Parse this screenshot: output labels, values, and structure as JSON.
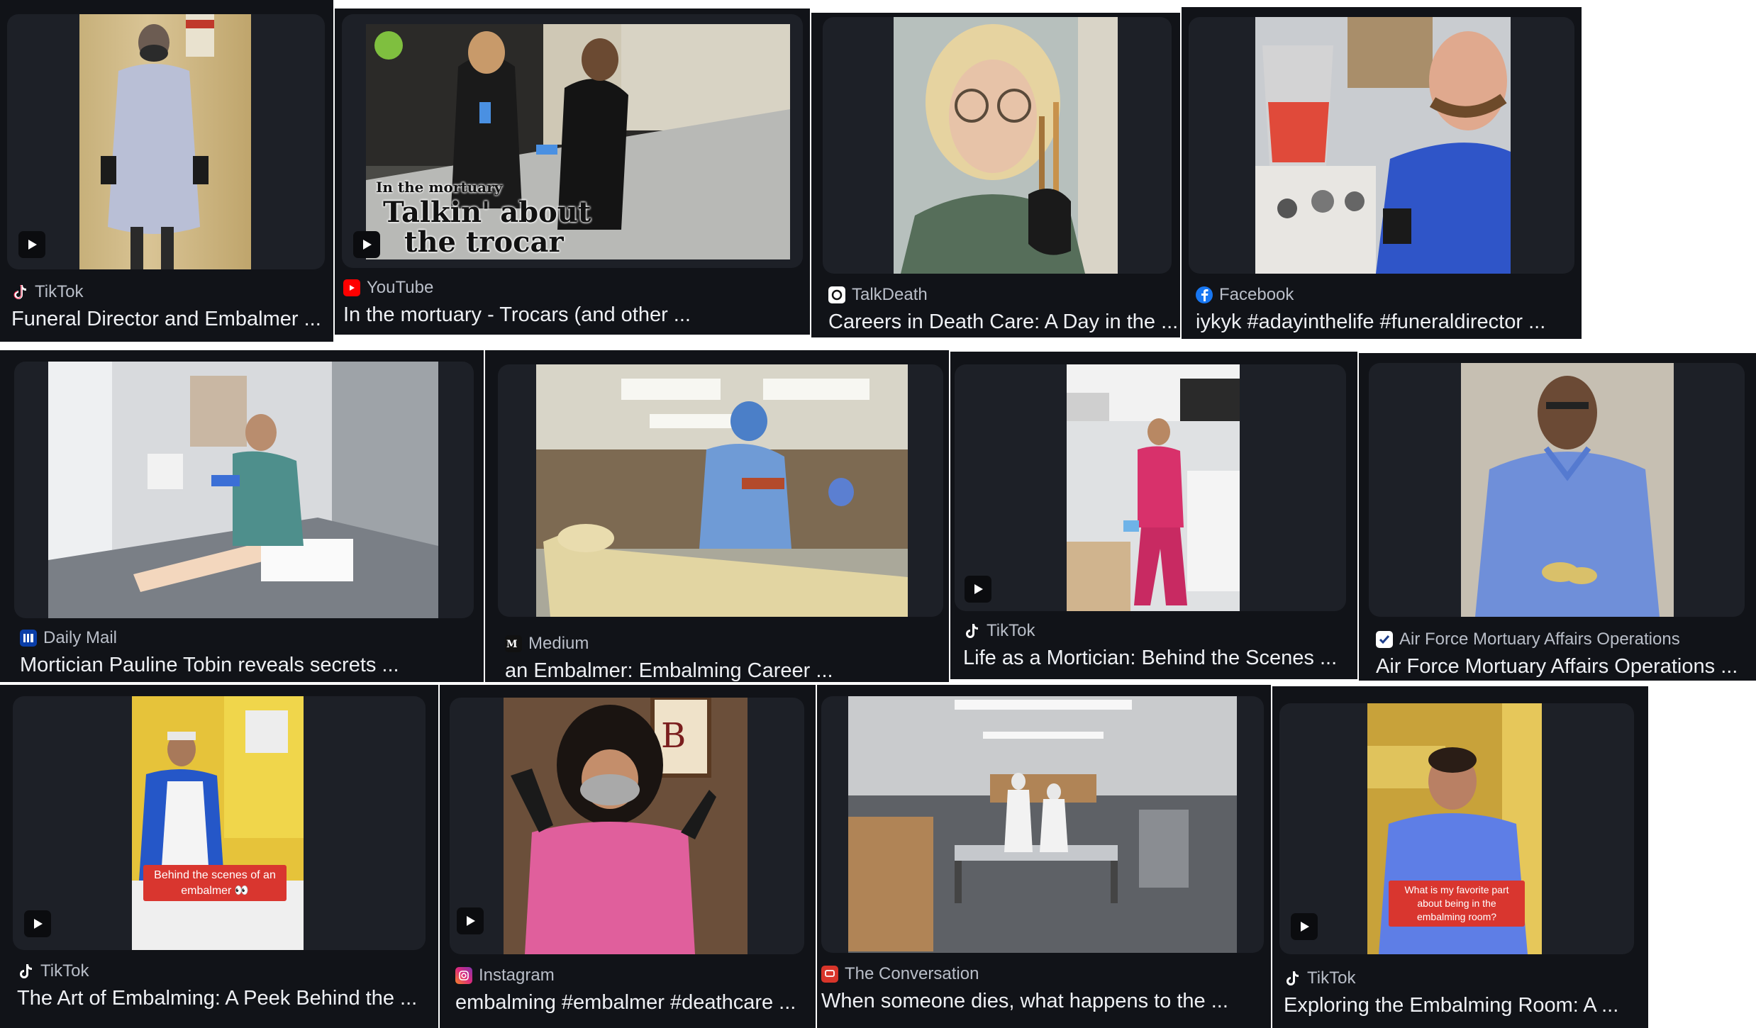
{
  "results": [
    {
      "source": "TikTok",
      "source_icon": "tiktok-icon",
      "title": "Funeral Director and Embalmer ...",
      "video": true
    },
    {
      "source": "YouTube",
      "source_icon": "youtube-icon",
      "title": "In the mortuary - Trocars (and other ...",
      "video": true,
      "overlay_small": "In the mortuary",
      "overlay_big1": "Talkin' about",
      "overlay_big2": "the trocar"
    },
    {
      "source": "TalkDeath",
      "source_icon": "talkdeath-icon",
      "title": "Careers in Death Care: A Day in the ...",
      "video": false
    },
    {
      "source": "Facebook",
      "source_icon": "facebook-icon",
      "title": "iykyk #adayinthelife #funeraldirector ...",
      "video": false
    },
    {
      "source": "Daily Mail",
      "source_icon": "dailymail-icon",
      "title": "Mortician Pauline Tobin reveals secrets ...",
      "video": false
    },
    {
      "source": "Medium",
      "source_icon": "medium-icon",
      "title": "an Embalmer: Embalming Career ...",
      "video": false
    },
    {
      "source": "TikTok",
      "source_icon": "tiktok-icon",
      "title": "Life as a Mortician: Behind the Scenes ...",
      "video": true
    },
    {
      "source": "Air Force Mortuary Affairs Operations",
      "source_icon": "afmao-icon",
      "title": "Air Force Mortuary Affairs Operations ...",
      "video": false
    },
    {
      "source": "TikTok",
      "source_icon": "tiktok-icon",
      "title": "The Art of Embalming: A Peek Behind the ...",
      "video": true,
      "caption": "Behind the scenes of an embalmer 👀"
    },
    {
      "source": "Instagram",
      "source_icon": "instagram-icon",
      "title": "embalming #embalmer #deathcare ...",
      "video": true
    },
    {
      "source": "The Conversation",
      "source_icon": "conversation-icon",
      "title": "When someone dies, what happens to the ...",
      "video": false
    },
    {
      "source": "TikTok",
      "source_icon": "tiktok-icon",
      "title": "Exploring the Embalming Room: A ...",
      "video": true,
      "caption": "What is my favorite part about being in the embalming room?"
    }
  ]
}
